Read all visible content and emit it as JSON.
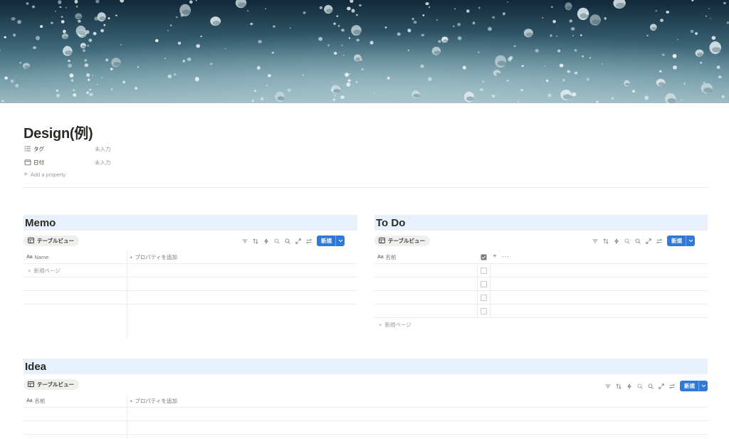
{
  "cover": {
    "description_colors": {
      "top": "#0f2a36",
      "mid": "#5a8090",
      "bottom": "#8fb2bd"
    }
  },
  "page": {
    "title": "Design(例)"
  },
  "properties": [
    {
      "icon": "list-icon",
      "name": "タグ",
      "value": "未入力"
    },
    {
      "icon": "calendar-icon",
      "name": "日付",
      "value": "未入力"
    }
  ],
  "add_property": "Add a property",
  "memo": {
    "heading": "Memo",
    "view_tab": "テーブルビュー",
    "new_button": "新規",
    "column_name": "Name",
    "add_property_col": "プロパティを追加",
    "new_page": "新規ページ"
  },
  "todo": {
    "heading": "To Do",
    "view_tab": "テーブルビュー",
    "new_button": "新規",
    "column_name": "名前",
    "new_page": "新規ページ",
    "rows": [
      {
        "name": "",
        "done": false
      },
      {
        "name": "",
        "done": false
      },
      {
        "name": "",
        "done": false
      },
      {
        "name": "",
        "done": false
      }
    ]
  },
  "idea": {
    "heading": "Idea",
    "view_tab": "テーブルビュー",
    "new_button": "新規",
    "column_name": "名前",
    "add_property_col": "プロパティを追加"
  },
  "colors": {
    "accent": "#2f7ad6",
    "heading_bg": "#e8f1fb"
  }
}
